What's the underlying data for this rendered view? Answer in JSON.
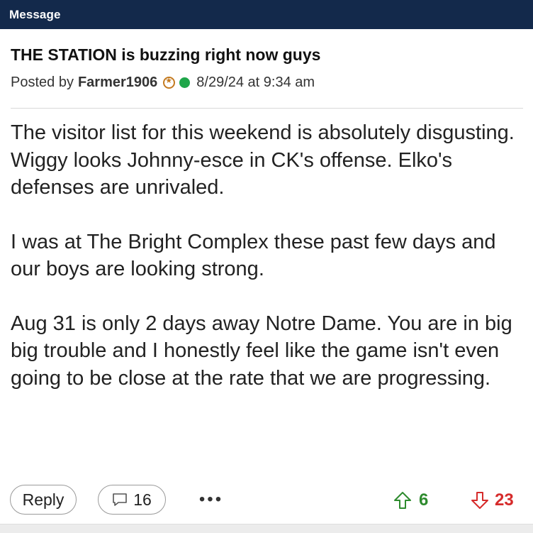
{
  "header": {
    "title": "Message"
  },
  "post": {
    "title": "THE STATION is buzzing right now guys",
    "posted_by_label": "Posted by",
    "author": "Farmer1906",
    "timestamp": "8/29/24 at 9:34 am",
    "paragraphs": [
      "The visitor list for this weekend is absolutely disgusting. Wiggy looks Johnny-esce in CK's offense. Elko's defenses are unrivaled.",
      "I was at The Bright Complex these past few days and our boys are looking strong.",
      "Aug 31 is only 2 days away Notre Dame. You are in big big trouble and I honestly feel like the game isn't even going to be close at the rate that we are progressing."
    ]
  },
  "actions": {
    "reply_label": "Reply",
    "comment_count": "16",
    "more_label": "•••",
    "upvotes": "6",
    "downvotes": "23"
  },
  "colors": {
    "header_bg": "#13294b",
    "online": "#1fa64a",
    "upvote": "#2e8b2e",
    "downvote": "#d62b2b"
  },
  "icons": {
    "badge": "star-badge-icon",
    "status": "online-dot-icon",
    "comment": "comment-icon",
    "upvote": "arrow-up-icon",
    "downvote": "arrow-down-icon"
  }
}
